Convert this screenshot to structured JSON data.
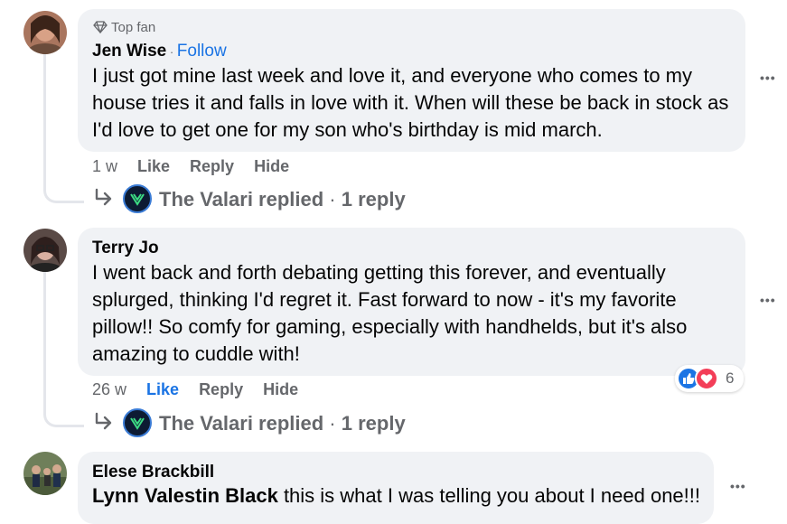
{
  "comments": [
    {
      "badge": "Top fan",
      "author": "Jen Wise",
      "follow": "Follow",
      "follow_sep": " · ",
      "text": "I just got mine last week and love it, and everyone who comes to my house tries it and falls in love with it. When will these be back in stock as I'd love to get one for my son who's birthday is mid march.",
      "time": "1 w",
      "like": "Like",
      "reply": "Reply",
      "hide": "Hide",
      "replied_author": "The Valari replied",
      "replied_sep": " · ",
      "replied_count": "1 reply"
    },
    {
      "author": "Terry Jo",
      "text": "I went back and forth debating getting this forever, and eventually splurged, thinking I'd regret it. Fast forward to now - it's my favorite pillow!! So comfy for gaming, especially with handhelds, but it's also amazing to cuddle with!",
      "time": "26 w",
      "like": "Like",
      "reply": "Reply",
      "hide": "Hide",
      "reaction_count": "6",
      "replied_author": "The Valari replied",
      "replied_sep": " · ",
      "replied_count": "1 reply"
    },
    {
      "author": "Elese Brackbill",
      "mention": "Lynn Valestin Black",
      "text": " this is what I was telling you about I need one!!!"
    }
  ],
  "more_icon": "•••",
  "colors": {
    "bubble": "#f0f2f5",
    "link_blue": "#1b74e4",
    "meta_gray": "#65676b",
    "love_red": "#f33e58"
  }
}
